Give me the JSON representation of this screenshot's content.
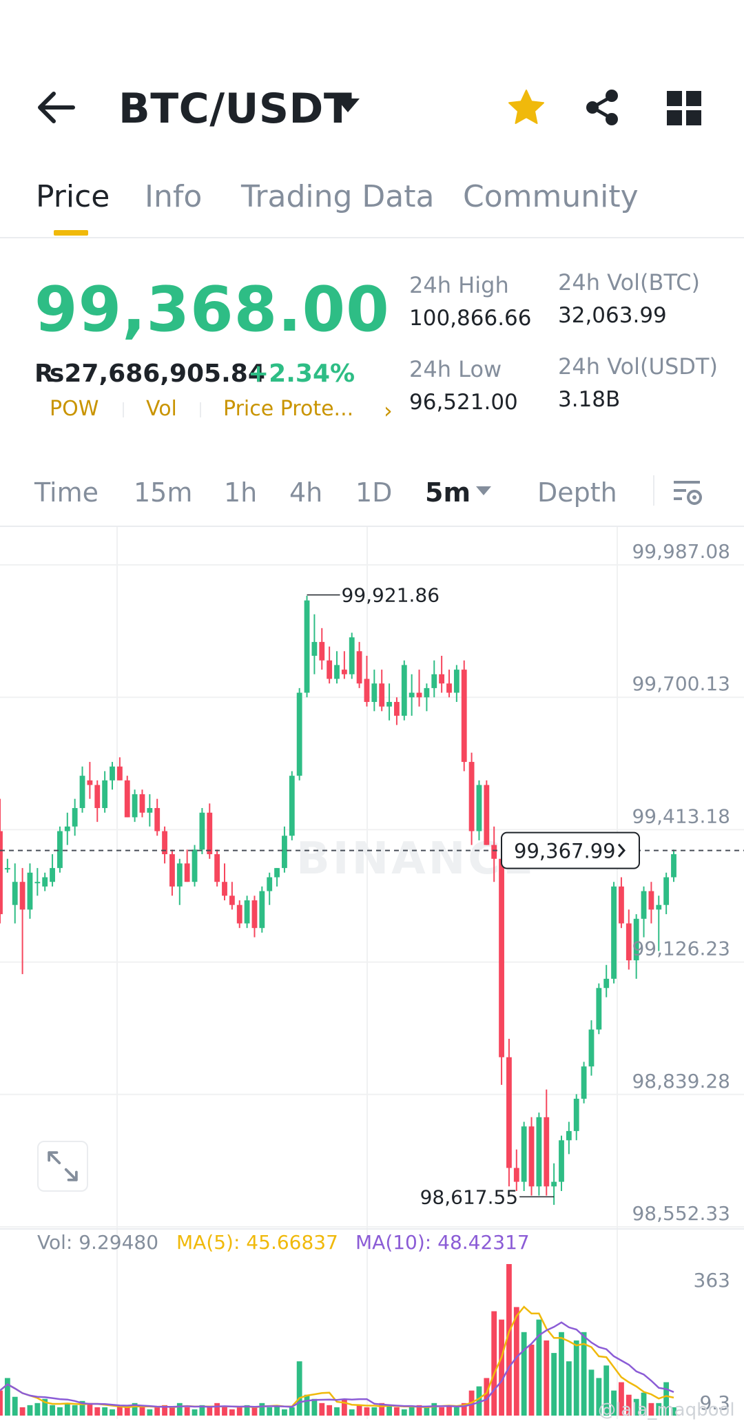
{
  "header": {
    "pair": "BTC/USDT",
    "icons": [
      "back-arrow-icon",
      "dropdown-caret-icon",
      "star-icon",
      "share-icon",
      "grid-icon"
    ],
    "star_color": "#F0B90B"
  },
  "tabs": [
    {
      "label": "Price",
      "active": true
    },
    {
      "label": "Info",
      "active": false
    },
    {
      "label": "Trading Data",
      "active": false
    },
    {
      "label": "Community",
      "active": false
    }
  ],
  "price": {
    "last": "99,368.00",
    "fiat": "₨27,686,905.84",
    "change": "+2.34%",
    "color_up": "#2EBD85",
    "color_down": "#F6465D"
  },
  "tags": [
    "POW",
    "Vol",
    "Price Prote..."
  ],
  "stats": {
    "high_label": "24h High",
    "high_value": "100,866.66",
    "low_label": "24h Low",
    "low_value": "96,521.00",
    "vol_btc_label": "24h Vol(BTC)",
    "vol_btc_value": "32,063.99",
    "vol_usdt_label": "24h Vol(USDT)",
    "vol_usdt_value": "3.18B"
  },
  "timeframes": [
    {
      "label": "Time",
      "active": false
    },
    {
      "label": "15m",
      "active": false
    },
    {
      "label": "1h",
      "active": false
    },
    {
      "label": "4h",
      "active": false
    },
    {
      "label": "1D",
      "active": false
    },
    {
      "label": "5m",
      "active": true
    },
    {
      "label": "Depth",
      "active": false
    }
  ],
  "chart_data": {
    "type": "candlestick",
    "y_ticks": [
      "99,987.08",
      "99,700.13",
      "99,413.18",
      "99,126.23",
      "98,839.28",
      "98,552.33"
    ],
    "y_range": [
      98552.33,
      99987.08
    ],
    "high_marker": "99,921.86",
    "low_marker": "98,617.55",
    "current_price_label": "99,367.99",
    "current_price": 99367.99,
    "watermark": "BINANCE",
    "candles": [
      [
        99410,
        99480,
        99210,
        99230
      ],
      [
        99330,
        99350,
        99320,
        99330
      ],
      [
        99250,
        99340,
        99210,
        99300
      ],
      [
        99300,
        99330,
        99100,
        99240
      ],
      [
        99240,
        99340,
        99220,
        99320
      ],
      [
        99300,
        99330,
        99270,
        99300
      ],
      [
        99290,
        99320,
        99280,
        99310
      ],
      [
        99300,
        99360,
        99290,
        99330
      ],
      [
        99330,
        99420,
        99320,
        99410
      ],
      [
        99410,
        99450,
        99380,
        99420
      ],
      [
        99420,
        99480,
        99400,
        99460
      ],
      [
        99460,
        99550,
        99450,
        99530
      ],
      [
        99520,
        99560,
        99480,
        99510
      ],
      [
        99510,
        99520,
        99430,
        99460
      ],
      [
        99460,
        99540,
        99450,
        99520
      ],
      [
        99520,
        99560,
        99500,
        99550
      ],
      [
        99550,
        99570,
        99520,
        99520
      ],
      [
        99520,
        99530,
        99440,
        99440
      ],
      [
        99440,
        99500,
        99430,
        99490
      ],
      [
        99490,
        99500,
        99440,
        99450
      ],
      [
        99450,
        99490,
        99420,
        99460
      ],
      [
        99460,
        99480,
        99400,
        99410
      ],
      [
        99410,
        99420,
        99340,
        99360
      ],
      [
        99360,
        99370,
        99270,
        99290
      ],
      [
        99290,
        99350,
        99250,
        99340
      ],
      [
        99340,
        99370,
        99300,
        99300
      ],
      [
        99300,
        99380,
        99290,
        99370
      ],
      [
        99370,
        99460,
        99360,
        99450
      ],
      [
        99450,
        99470,
        99350,
        99360
      ],
      [
        99360,
        99370,
        99290,
        99300
      ],
      [
        99300,
        99340,
        99260,
        99270
      ],
      [
        99270,
        99300,
        99240,
        99250
      ],
      [
        99250,
        99260,
        99200,
        99210
      ],
      [
        99210,
        99270,
        99200,
        99260
      ],
      [
        99260,
        99270,
        99180,
        99200
      ],
      [
        99200,
        99290,
        99190,
        99280
      ],
      [
        99280,
        99320,
        99250,
        99310
      ],
      [
        99310,
        99330,
        99290,
        99330
      ],
      [
        99330,
        99420,
        99320,
        99400
      ],
      [
        99400,
        99540,
        99390,
        99530
      ],
      [
        99530,
        99720,
        99520,
        99710
      ],
      [
        99710,
        99920,
        99700,
        99910
      ],
      [
        99790,
        99880,
        99750,
        99820
      ],
      [
        99820,
        99850,
        99760,
        99780
      ],
      [
        99780,
        99810,
        99730,
        99740
      ],
      [
        99740,
        99800,
        99730,
        99770
      ],
      [
        99760,
        99800,
        99740,
        99750
      ],
      [
        99750,
        99840,
        99740,
        99830
      ],
      [
        99800,
        99820,
        99720,
        99730
      ],
      [
        99740,
        99790,
        99680,
        99690
      ],
      [
        99690,
        99760,
        99670,
        99730
      ],
      [
        99730,
        99760,
        99670,
        99680
      ],
      [
        99680,
        99730,
        99650,
        99690
      ],
      [
        99690,
        99700,
        99640,
        99660
      ],
      [
        99660,
        99780,
        99650,
        99770
      ],
      [
        99700,
        99750,
        99660,
        99710
      ],
      [
        99710,
        99760,
        99680,
        99700
      ],
      [
        99700,
        99730,
        99670,
        99720
      ],
      [
        99720,
        99780,
        99700,
        99750
      ],
      [
        99750,
        99790,
        99710,
        99730
      ],
      [
        99730,
        99760,
        99700,
        99710
      ],
      [
        99710,
        99770,
        99690,
        99760
      ],
      [
        99760,
        99780,
        99540,
        99560
      ],
      [
        99560,
        99580,
        99380,
        99410
      ],
      [
        99410,
        99520,
        99390,
        99510
      ],
      [
        99510,
        99520,
        99380,
        99380
      ],
      [
        99380,
        99420,
        99300,
        99350
      ],
      [
        99350,
        99360,
        98860,
        98920
      ],
      [
        98920,
        98960,
        98640,
        98680
      ],
      [
        98680,
        98720,
        98630,
        98650
      ],
      [
        98650,
        98780,
        98630,
        98770
      ],
      [
        98770,
        98790,
        98620,
        98640
      ],
      [
        98640,
        98800,
        98620,
        98790
      ],
      [
        98790,
        98850,
        98620,
        98640
      ],
      [
        98640,
        98690,
        98600,
        98650
      ],
      [
        98650,
        98750,
        98630,
        98740
      ],
      [
        98740,
        98780,
        98710,
        98760
      ],
      [
        98760,
        98840,
        98740,
        98830
      ],
      [
        98830,
        98910,
        98820,
        98900
      ],
      [
        98900,
        99000,
        98880,
        98980
      ],
      [
        98980,
        99080,
        98970,
        99070
      ],
      [
        99070,
        99120,
        99050,
        99090
      ],
      [
        99090,
        99300,
        99080,
        99290
      ],
      [
        99290,
        99310,
        99200,
        99210
      ],
      [
        99210,
        99240,
        99110,
        99130
      ],
      [
        99130,
        99230,
        99090,
        99220
      ],
      [
        99220,
        99290,
        99180,
        99280
      ],
      [
        99280,
        99300,
        99210,
        99240
      ],
      [
        99240,
        99270,
        99150,
        99250
      ],
      [
        99250,
        99320,
        99230,
        99310
      ],
      [
        99310,
        99370,
        99300,
        99360
      ]
    ],
    "volume": {
      "label": "Vol: 9.29480",
      "ma5_label": "MA(5): 45.66837",
      "ma10_label": "MA(10): 48.42317",
      "ma5_color": "#F0B90B",
      "ma10_color": "#8B5CD6",
      "y_ticks": [
        "363",
        "9.3"
      ],
      "y_range": [
        0,
        363
      ],
      "values": [
        60,
        90,
        45,
        20,
        25,
        30,
        40,
        25,
        20,
        30,
        25,
        35,
        30,
        20,
        20,
        15,
        25,
        20,
        30,
        20,
        15,
        20,
        25,
        20,
        30,
        20,
        15,
        25,
        20,
        30,
        20,
        15,
        20,
        25,
        20,
        30,
        20,
        25,
        15,
        20,
        130,
        50,
        40,
        30,
        25,
        20,
        40,
        15,
        25,
        20,
        20,
        30,
        25,
        20,
        15,
        20,
        25,
        20,
        30,
        20,
        25,
        20,
        30,
        60,
        70,
        90,
        250,
        230,
        363,
        260,
        200,
        170,
        230,
        180,
        150,
        200,
        130,
        180,
        200,
        110,
        90,
        120,
        60,
        80,
        50,
        40,
        55,
        30,
        30,
        80,
        20
      ]
    }
  },
  "watermark_user": "@lala_maqbool"
}
